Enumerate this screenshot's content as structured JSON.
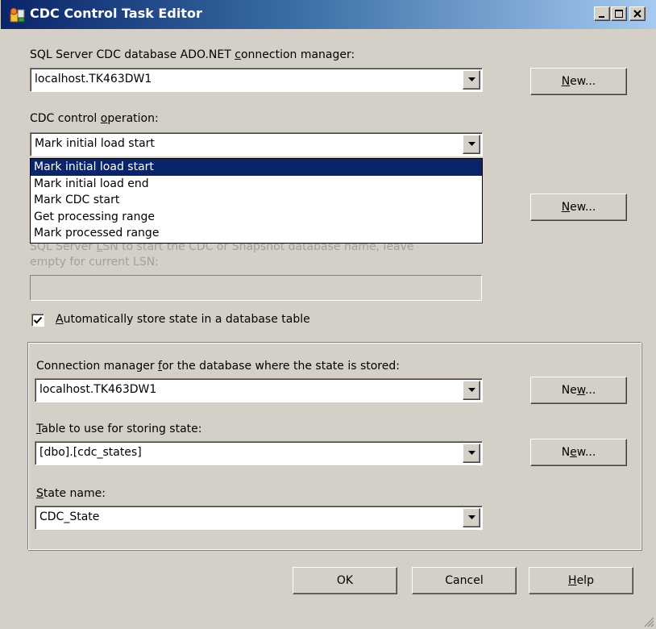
{
  "window": {
    "title": "CDC Control Task Editor",
    "buttons": [
      "minimize",
      "maximize",
      "close"
    ]
  },
  "connection": {
    "label_pre": "SQL Server CDC database ADO.NET ",
    "label_key": "c",
    "label_post": "onnection manager:",
    "value": "localhost.TK463DW1",
    "new_pre": "",
    "new_key": "N",
    "new_post": "ew..."
  },
  "operation": {
    "label_pre": "CDC control ",
    "label_key": "o",
    "label_post": "peration:",
    "value": "Mark initial load start",
    "options": [
      "Mark initial load start",
      "Mark initial load end",
      "Mark CDC start",
      "Get processing range",
      "Mark processed range"
    ],
    "selected_index": 0
  },
  "hidden_new_button": {
    "pre": "",
    "key": "N",
    "post": "ew..."
  },
  "lsn": {
    "label_line1_pre": "SQL Server ",
    "label_line1_key": "L",
    "label_line1_post": "SN to start the CDC or Snapshot database name, leave",
    "label_line2": "empty for current LSN:",
    "value": ""
  },
  "auto_store": {
    "checked": true,
    "label_pre": "",
    "label_key": "A",
    "label_post": "utomatically store state in a database table"
  },
  "state_connection": {
    "label_pre": "Connection manager ",
    "label_key": "f",
    "label_post": "or the database where the state is stored:",
    "value": "localhost.TK463DW1",
    "new_pre": "Ne",
    "new_key": "w",
    "new_post": "..."
  },
  "state_table": {
    "label_pre": "",
    "label_key": "T",
    "label_post": "able to use for storing state:",
    "value": "[dbo].[cdc_states]",
    "new_pre": "N",
    "new_key": "e",
    "new_post": "w..."
  },
  "state_name": {
    "label_pre": "",
    "label_key": "S",
    "label_post": "tate name:",
    "value": "CDC_State"
  },
  "footer": {
    "ok": "OK",
    "cancel": "Cancel",
    "help_pre": "",
    "help_key": "H",
    "help_post": "elp"
  },
  "colors": {
    "title_start": "#0a246a",
    "title_end": "#a6caf0",
    "face": "#d4d0c8",
    "selection": "#0a246a"
  }
}
